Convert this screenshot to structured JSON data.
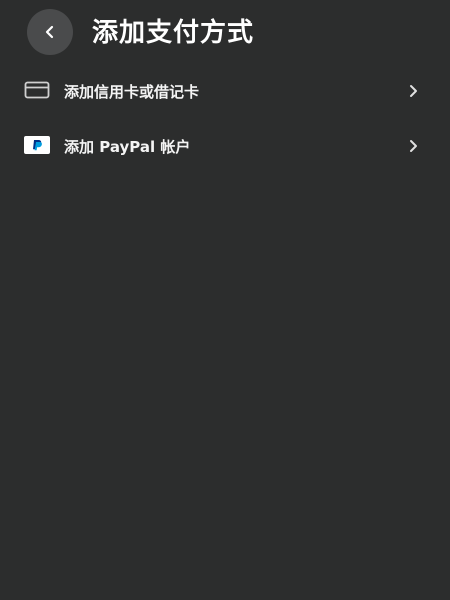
{
  "header": {
    "back_icon": "chevron-left-icon",
    "title": "添加支付方式"
  },
  "options": [
    {
      "icon": "credit-card-icon",
      "label": "添加信用卡或借记卡",
      "trailing_icon": "chevron-right-icon"
    },
    {
      "icon": "paypal-logo-icon",
      "label": "添加 PayPal 帐户",
      "trailing_icon": "chevron-right-icon"
    }
  ],
  "colors": {
    "background": "#2c2d2d",
    "back_button_bg": "#4a4b4c",
    "text": "#ffffff",
    "paypal_dark_blue": "#003087",
    "paypal_light_blue": "#009cde"
  }
}
